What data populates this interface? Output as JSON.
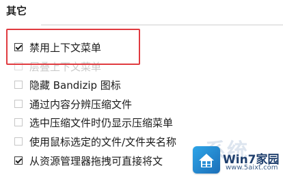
{
  "section": {
    "title": "其它"
  },
  "options": [
    {
      "label": "禁用上下文菜单",
      "checked": true,
      "state": "normal"
    },
    {
      "label": "层叠上下文菜单",
      "checked": false,
      "state": "faint"
    },
    {
      "label": "隐藏 Bandizip 图标",
      "checked": false,
      "state": "normal"
    },
    {
      "label": "通过内容分辨压缩文件",
      "checked": false,
      "state": "normal"
    },
    {
      "label": "选中压缩文件时仍显示压缩菜单",
      "checked": false,
      "state": "normal"
    },
    {
      "label": "使用鼠标选定的文件/文件夹名称",
      "checked": false,
      "state": "normal"
    },
    {
      "label": "从资源管理器拖拽可直接将文",
      "checked": true,
      "state": "normal"
    }
  ],
  "watermark": {
    "title": "Win7家园",
    "url": "www.5aixt.com",
    "swoosh": "系统"
  },
  "colors": {
    "highlight": "#e03a3f",
    "watermark_logo": "#2ea5e8"
  }
}
